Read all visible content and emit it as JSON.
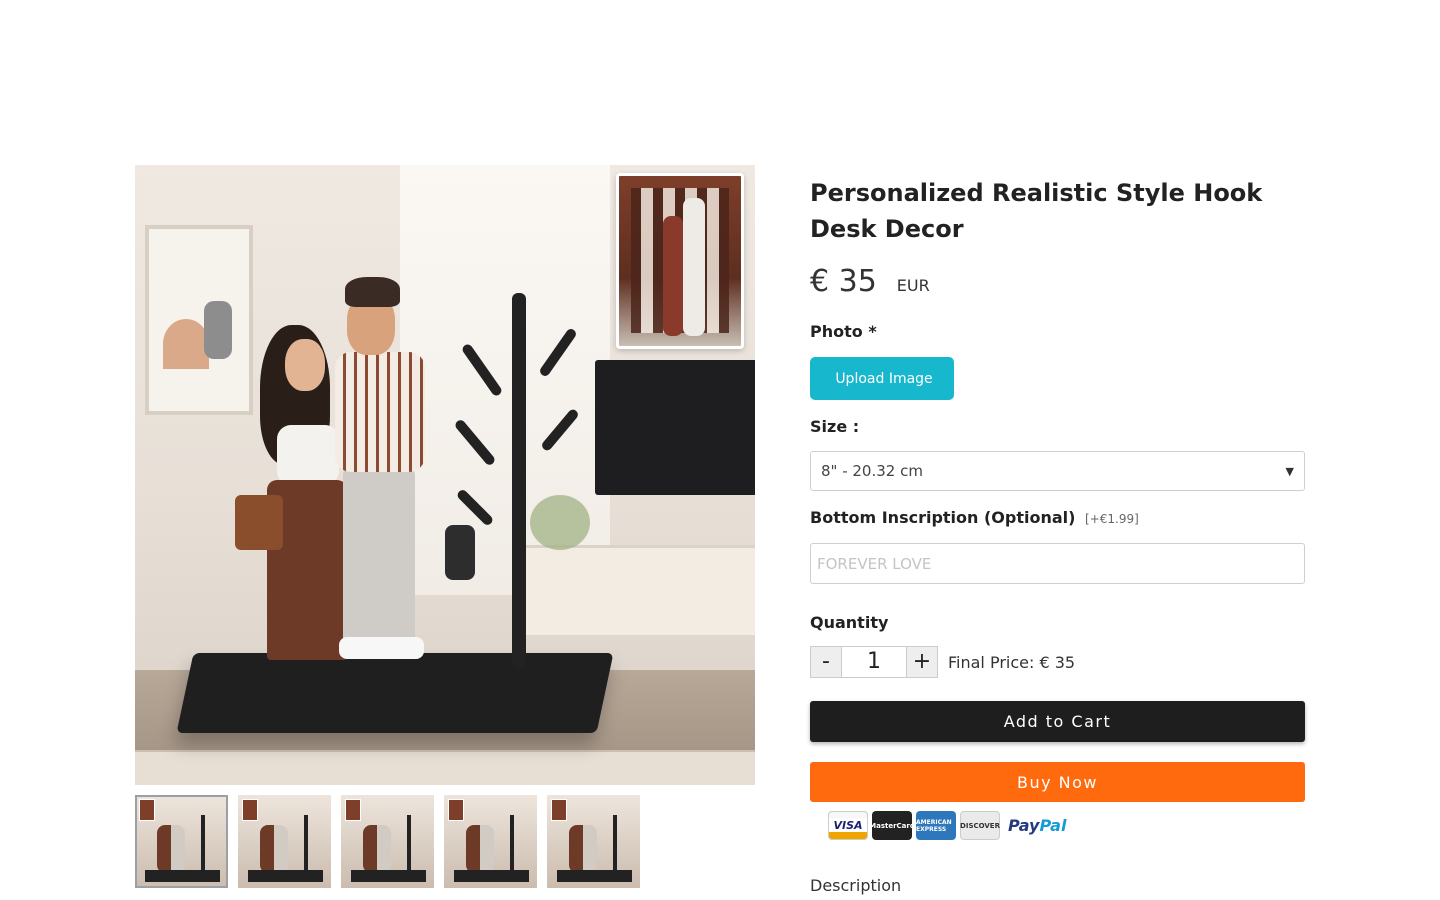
{
  "product": {
    "title": "Personalized Realistic Style Hook Desk Decor",
    "price": "€ 35",
    "currency": "EUR"
  },
  "photo": {
    "label": "Photo *",
    "upload_icon": "",
    "upload_label": "Upload Image"
  },
  "size": {
    "label": "Size :",
    "selected": "8\" - 20.32 cm"
  },
  "inscription": {
    "label": "Bottom Inscription (Optional)",
    "extra": "[+€1.99]",
    "placeholder": "FOREVER LOVE"
  },
  "quantity": {
    "label": "Quantity",
    "minus": "-",
    "value": "1",
    "plus": "+",
    "final_price": "Final Price: € 35"
  },
  "buttons": {
    "add_to_cart": "Add to Cart",
    "buy_now": "Buy Now"
  },
  "payments": {
    "visa": "VISA",
    "mastercard": "MasterCard",
    "amex": "AMERICAN EXPRESS",
    "discover": "DISCOVER",
    "paypal_a": "Pay",
    "paypal_b": "Pal"
  },
  "description": {
    "label": "Description",
    "chevron": ""
  },
  "colors": {
    "upload": "#17b8ce",
    "cart": "#1e1e1e",
    "buy": "#ff6a0f"
  }
}
